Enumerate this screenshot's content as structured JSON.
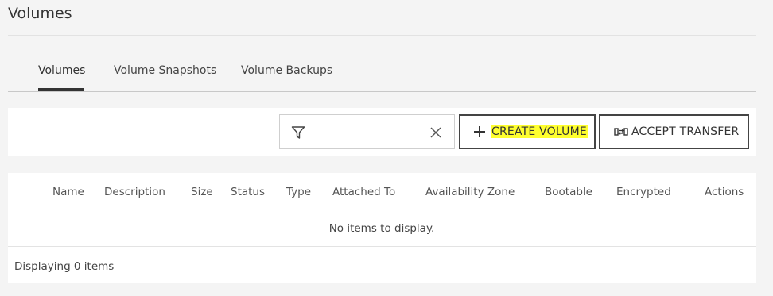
{
  "page": {
    "title": "Volumes"
  },
  "tabs": [
    {
      "label": "Volumes",
      "active": true
    },
    {
      "label": "Volume Snapshots",
      "active": false
    },
    {
      "label": "Volume Backups",
      "active": false
    }
  ],
  "toolbar": {
    "filter": {
      "value": "",
      "placeholder": "",
      "icon": "filter-icon",
      "clear_icon": "close-icon"
    },
    "create_label": "CREATE VOLUME",
    "create_icon": "plus-icon",
    "accept_label": "ACCEPT TRANSFER",
    "accept_icon": "transfer-icon",
    "highlight_color": "#ffff2e"
  },
  "table": {
    "columns": [
      "Name",
      "Description",
      "Size",
      "Status",
      "Type",
      "Attached To",
      "Availability Zone",
      "Bootable",
      "Encrypted",
      "Actions"
    ],
    "empty_message": "No items to display.",
    "footer": "Displaying 0 items"
  }
}
